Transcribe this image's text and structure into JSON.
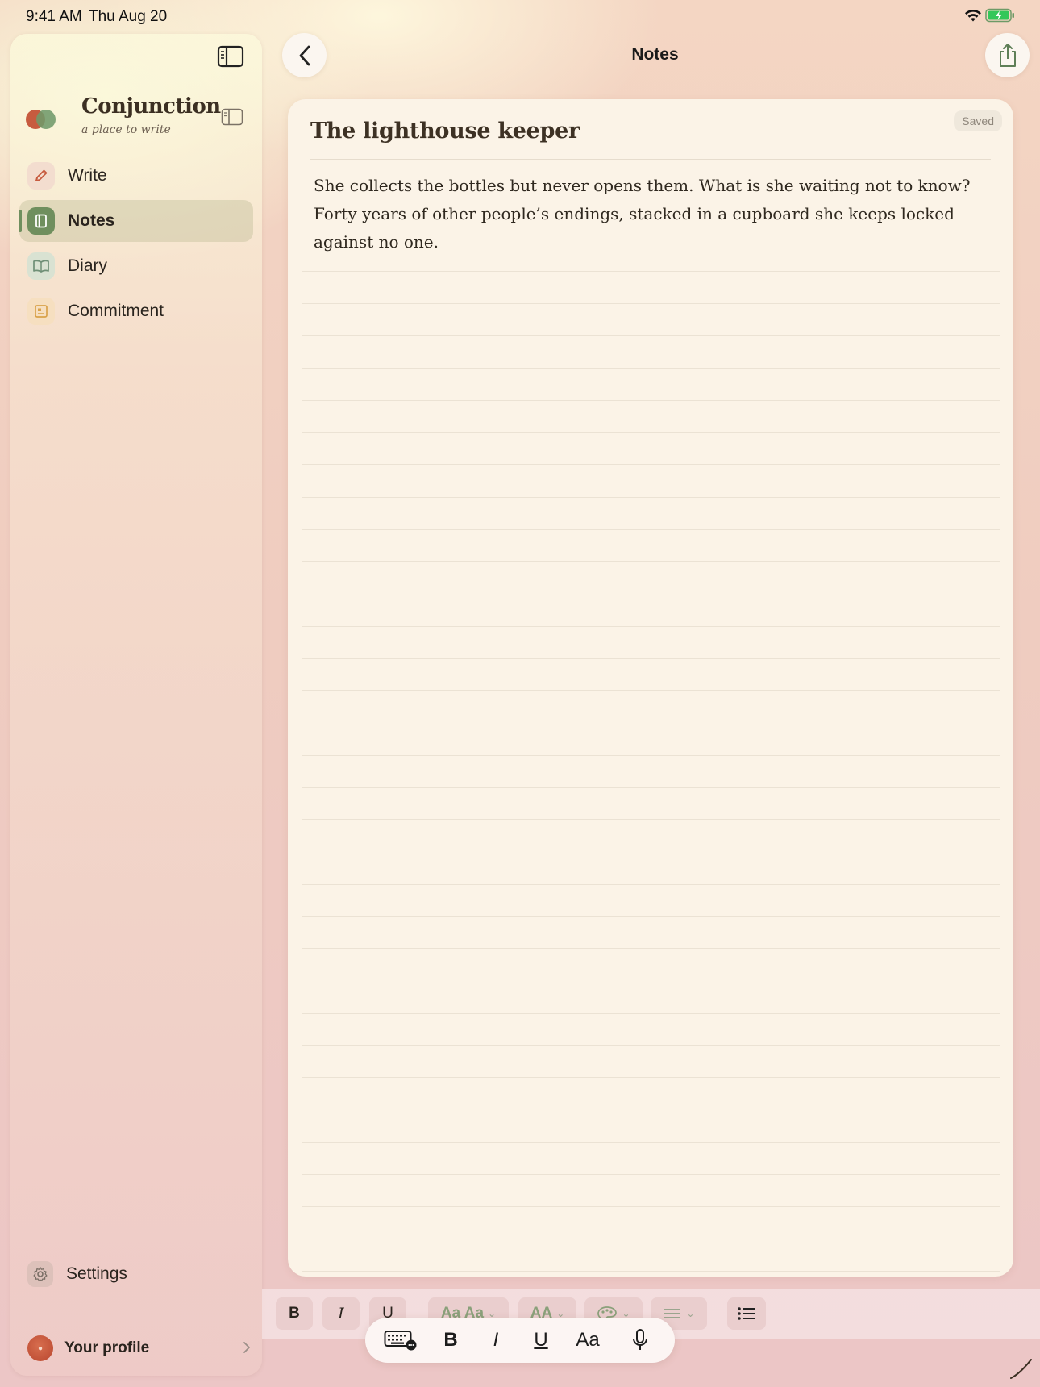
{
  "status_bar": {
    "time": "9:41 AM",
    "date": "Thu Aug 20",
    "icons": [
      "wifi-icon",
      "battery-charging-icon"
    ],
    "battery_color": "#34c759"
  },
  "sidebar": {
    "brand": {
      "name": "Conjunction",
      "tagline": "a place to write",
      "logo_colors": [
        "#c75b3f",
        "#6f9a6a"
      ]
    },
    "nav_items": [
      {
        "label": "Write",
        "icon": "pencil-icon",
        "active": false,
        "icon_bg": "#f3ddcf",
        "icon_color": "#c75b3f"
      },
      {
        "label": "Notes",
        "icon": "notebook-icon",
        "active": true,
        "icon_bg": "#6f8f5e",
        "icon_color": "#ffffff"
      },
      {
        "label": "Diary",
        "icon": "open-book-icon",
        "active": false,
        "icon_bg": "#d9e2d2",
        "icon_color": "#6f8f76"
      },
      {
        "label": "Commitment",
        "icon": "id-card-icon",
        "active": false,
        "icon_bg": "#f6dfc0",
        "icon_color": "#d9a24a"
      }
    ],
    "settings": {
      "label": "Settings",
      "icon": "gear-icon"
    },
    "profile": {
      "label": "Your profile",
      "icon": "chevron-right-icon"
    }
  },
  "header": {
    "title": "Notes",
    "back_icon": "chevron-left-icon",
    "share_icon": "share-icon"
  },
  "editor": {
    "status": "Saved",
    "note_title": "The lighthouse keeper",
    "note_body": "She collects the bottles but never opens them. What is she waiting not to know? Forty years of other people’s endings, stacked in a cupboard she keeps locked against no one."
  },
  "format_toolbar": {
    "bold": "B",
    "italic": "I",
    "underline": "U",
    "font_style": "Aa Aa",
    "font_size": "AA",
    "color_icon": "palette-icon",
    "align_icon": "align-icon",
    "list_icon": "bullet-list-icon"
  },
  "keyboard_bar": {
    "keyboard_icon": "keyboard-icon",
    "bold": "B",
    "italic": "I",
    "underline": "U",
    "text_style": "Aa",
    "mic_icon": "microphone-icon"
  },
  "colors": {
    "accent_green": "#6f8f5e",
    "brand_text": "#3b2f22",
    "paper": "#fbf3e7"
  }
}
